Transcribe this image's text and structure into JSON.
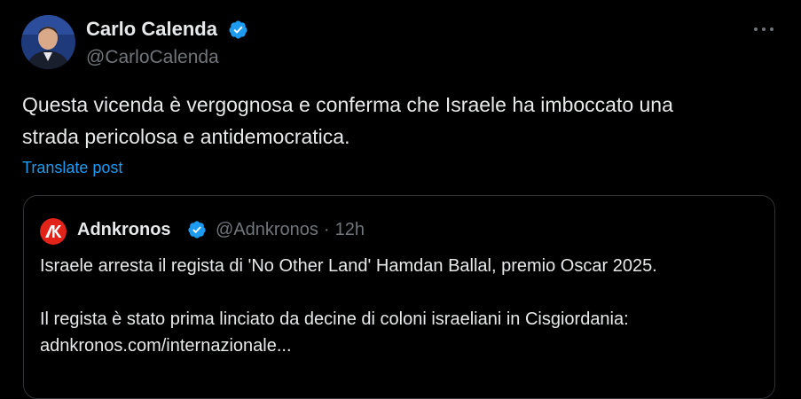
{
  "post": {
    "author": {
      "name": "Carlo Calenda",
      "handle": "@CarloCalenda",
      "verified": true
    },
    "text_line1": "Questa vicenda è vergognosa e conferma che Israele ha imboccato una",
    "text_line2": "strada pericolosa e antidemocratica.",
    "translate_label": "Translate post",
    "more_icon": "more-horizontal-icon"
  },
  "quoted_post": {
    "author": {
      "name": "Adnkronos",
      "handle": "@Adnkronos",
      "verified": true
    },
    "separator": "·",
    "time": "12h",
    "paragraph1": "Israele arresta il regista di 'No Other Land' Hamdan Ballal, premio Oscar 2025.",
    "paragraph2_line1": "Il regista è stato prima linciato da decine di coloni israeliani in Cisgiordania:",
    "paragraph2_line2": "adnkronos.com/internazionale..."
  },
  "colors": {
    "background": "#000000",
    "text_primary": "#e7e9ea",
    "text_secondary": "#71767b",
    "link": "#1d9bf0",
    "verified": "#1d9bf0",
    "border": "#2f3336",
    "adnkronos_red": "#e2231a"
  }
}
